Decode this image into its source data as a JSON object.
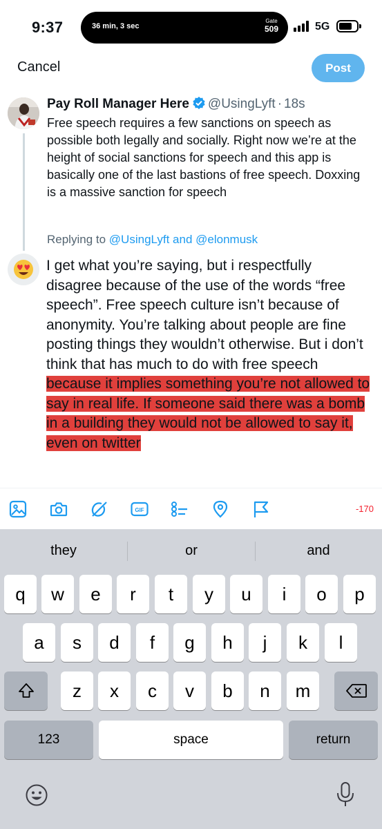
{
  "status_bar": {
    "time": "9:37",
    "timer": "36 min, 3 sec",
    "gate_label": "Gate",
    "gate_number": "509",
    "network": "5G"
  },
  "header": {
    "cancel_label": "Cancel",
    "post_label": "Post"
  },
  "original_tweet": {
    "name": "Pay Roll Manager Here",
    "handle": "@UsingLyft",
    "separator": "·",
    "time": "18s",
    "body": "Free speech requires a few sanctions on speech as possible both legally and socially. Right now we’re at the height of social sanctions for speech and this app is basically one of the last bastions of free speech. Doxxing is a massive sanction for speech"
  },
  "replying": {
    "prefix": "Replying to",
    "mention1": "@UsingLyft",
    "conjunction": "and",
    "mention2": "@elonmusk"
  },
  "reply": {
    "avatar_emoji": "😍",
    "text_plain": "I get what you’re saying, but i respectfully disagree because of the use of the words “free speech”. Free speech culture isn’t because of anonymity. You’re talking about people are fine posting things they wouldn’t otherwise. But i don’t think that has much to do with free speech",
    "text_highlighted": " because it implies something you’re not allowed to say in real life. If someone said there was a bomb in a building they would not be allowed to say it, even on twitter"
  },
  "toolbar": {
    "icons": [
      "image-icon",
      "camera-icon",
      "grok-icon",
      "gif-icon",
      "poll-icon",
      "location-icon",
      "flag-icon"
    ],
    "gif_label": "GIF",
    "char_count": "-170",
    "accent_color": "#1d9bf0",
    "error_color": "#f4212e"
  },
  "keyboard": {
    "suggestions": [
      "they",
      "or",
      "and"
    ],
    "row1": [
      "q",
      "w",
      "e",
      "r",
      "t",
      "y",
      "u",
      "i",
      "o",
      "p"
    ],
    "row2": [
      "a",
      "s",
      "d",
      "f",
      "g",
      "h",
      "j",
      "k",
      "l"
    ],
    "row3": [
      "z",
      "x",
      "c",
      "v",
      "b",
      "n",
      "m"
    ],
    "numbers_label": "123",
    "space_label": "space",
    "return_label": "return"
  },
  "colors": {
    "post_button": "#60b5ee",
    "highlight": "#e0403c",
    "link": "#1d9bf0"
  }
}
